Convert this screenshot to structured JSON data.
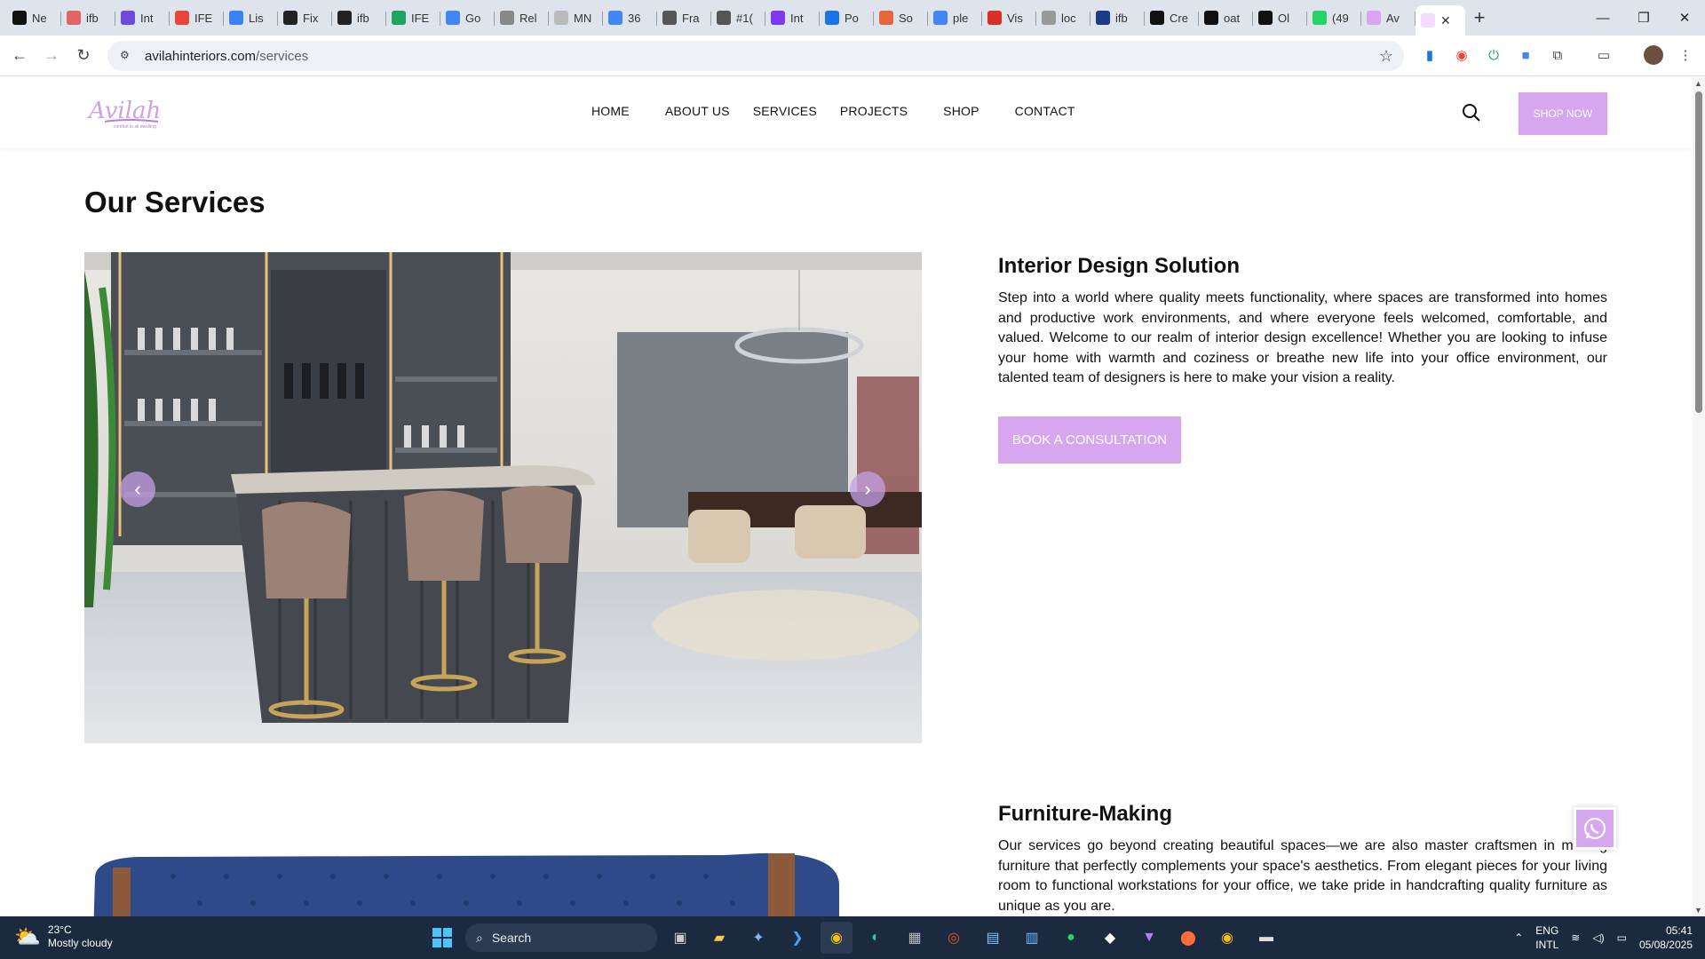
{
  "browser": {
    "tabs": [
      {
        "label": "Ne",
        "color": "#111111"
      },
      {
        "label": "ifb",
        "color": "#e06666"
      },
      {
        "label": "Int",
        "color": "#6c4cd8"
      },
      {
        "label": "IFE",
        "color": "#e8453c"
      },
      {
        "label": "Lis",
        "color": "#3b82f6"
      },
      {
        "label": "Fix",
        "color": "#222222"
      },
      {
        "label": "ifb",
        "color": "#222222"
      },
      {
        "label": "IFE",
        "color": "#1ea362"
      },
      {
        "label": "Go",
        "color": "#4285f4"
      },
      {
        "label": "Rel",
        "color": "#888888"
      },
      {
        "label": "MN",
        "color": "#bbbbbb"
      },
      {
        "label": "36",
        "color": "#4285f4"
      },
      {
        "label": "Fra",
        "color": "#555555"
      },
      {
        "label": "#1(",
        "color": "#555555"
      },
      {
        "label": "Int",
        "color": "#7c3aed"
      },
      {
        "label": "Po",
        "color": "#1a73e8"
      },
      {
        "label": "So",
        "color": "#e8663c"
      },
      {
        "label": "ple",
        "color": "#4285f4"
      },
      {
        "label": "Vis",
        "color": "#d93025"
      },
      {
        "label": "loc",
        "color": "#999999"
      },
      {
        "label": "ifb",
        "color": "#1a3a8a"
      },
      {
        "label": "Cre",
        "color": "#111111"
      },
      {
        "label": "oat",
        "color": "#111111"
      },
      {
        "label": "Ol",
        "color": "#111111"
      },
      {
        "label": "(49",
        "color": "#25d366"
      },
      {
        "label": "Av",
        "color": "#d6a6ef"
      }
    ],
    "active_tab_close": "✕",
    "new_tab": "+",
    "url_host": "avilahinteriors.com",
    "url_path": "/services"
  },
  "site": {
    "logo_text": "Avilah",
    "logo_tagline": "comfort in all dwelling",
    "nav": [
      "HOME",
      "ABOUT US",
      "SERVICES",
      "PROJECTS",
      "SHOP",
      "CONTACT"
    ],
    "shop_now": "SHOP NOW",
    "page_title": "Our Services",
    "services": [
      {
        "title": "Interior Design Solution",
        "text": "Step into a world where quality meets functionality, where spaces are transformed into homes and productive work environments, and where everyone feels welcomed, comfortable, and valued. Welcome to our realm of interior design excellence! Whether you are looking to infuse your home with warmth and coziness or breathe new life into your office environment, our talented team of designers is here to make your vision a reality.",
        "button": "BOOK A CONSULTATION"
      },
      {
        "title": "Furniture-Making",
        "text": "Our services go beyond creating beautiful spaces—we are also master craftsmen in making furniture that perfectly complements your space's aesthetics. From elegant pieces for your living room to functional workstations for your office, we take pride in handcrafting quality furniture as unique as you are."
      }
    ],
    "slider_prev": "‹",
    "slider_next": "›",
    "accent": "#d6a6ef"
  },
  "taskbar": {
    "temp": "23°C",
    "weather": "Mostly cloudy",
    "search_placeholder": "Search",
    "lang1": "ENG",
    "lang2": "INTL",
    "time": "05:41",
    "date": "05/08/2025"
  }
}
